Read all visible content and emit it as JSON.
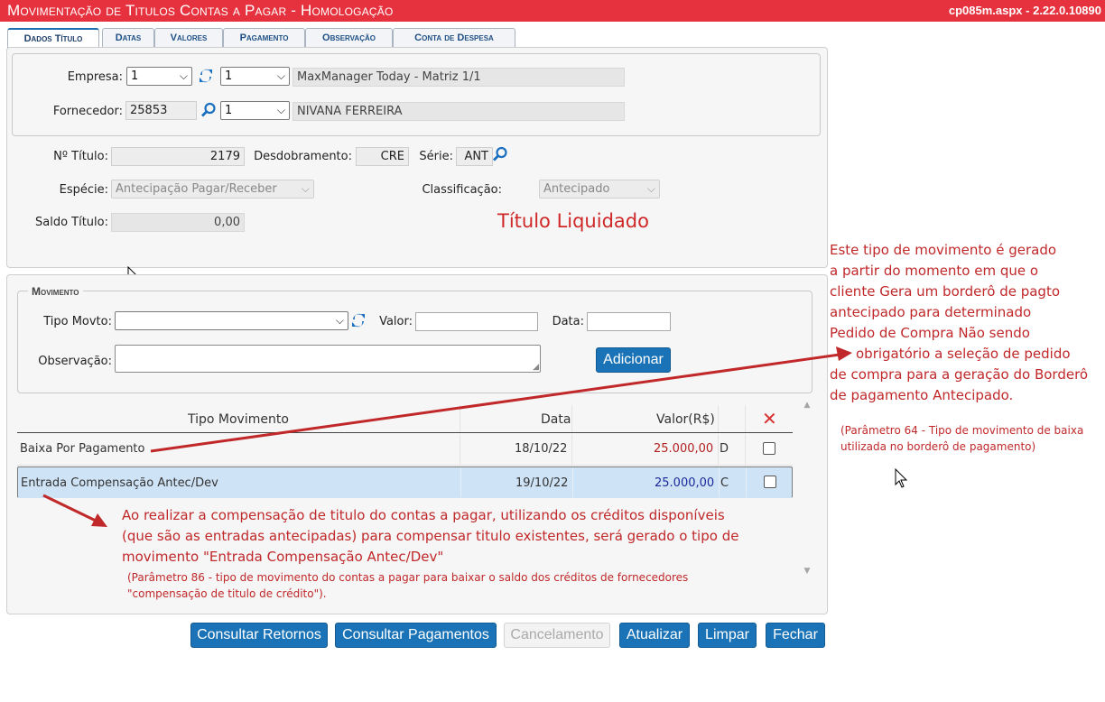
{
  "header": {
    "title": "Movimentação de Titulos Contas a Pagar  - Homologação",
    "version": "cp085m.aspx - 2.22.0.10890",
    "bg_color": "#e5323e"
  },
  "tabs": [
    {
      "label": "Dados Título",
      "active": true
    },
    {
      "label": "Datas",
      "active": false
    },
    {
      "label": "Valores",
      "active": false
    },
    {
      "label": "Pagamento",
      "active": false
    },
    {
      "label": "Observação",
      "active": false
    },
    {
      "label": "Conta de Despesa",
      "active": false
    }
  ],
  "empresa": {
    "label": "Empresa:",
    "select_value": "1",
    "filial_value": "1",
    "name": "MaxManager Today - Matriz 1/1",
    "refresh_icon": "refresh-icon"
  },
  "fornecedor": {
    "label": "Fornecedor:",
    "code": "25853",
    "seq_value": "1",
    "name": "NIVANA FERREIRA",
    "search_icon": "search-icon"
  },
  "titulo": {
    "numero_label": "Nº Título:",
    "numero": "2179",
    "desdobramento_label": "Desdobramento:",
    "desdobramento": "CRE",
    "serie_label": "Série:",
    "serie": "ANT",
    "especie_label": "Espécie:",
    "especie": "Antecipação Pagar/Receber",
    "classificacao_label": "Classificação:",
    "classificacao": "Antecipado",
    "saldo_label": "Saldo Título:",
    "saldo": "0,00",
    "status": "Título Liquidado"
  },
  "movimento": {
    "legend": "Movimento",
    "tipo_label": "Tipo Movto:",
    "tipo_value": "",
    "valor_label": "Valor:",
    "valor_value": "",
    "data_label": "Data:",
    "data_value": "",
    "obs_label": "Observação:",
    "obs_value": "",
    "add_button": "Adicionar"
  },
  "grid": {
    "columns": [
      "Tipo Movimento",
      "Data",
      "Valor(R$)"
    ],
    "delete_icon": "x-icon",
    "rows": [
      {
        "tipo": "Baixa Por Pagamento",
        "data": "18/10/22",
        "valor": "25.000,00",
        "dc": "D",
        "valor_color": "#b22222",
        "checked": false,
        "selected": false
      },
      {
        "tipo": "Entrada Compensação Antec/Dev",
        "data": "19/10/22",
        "valor": "25.000,00",
        "dc": "C",
        "valor_color": "#1a2a9a",
        "checked": false,
        "selected": true
      }
    ]
  },
  "annotations": {
    "right_main": [
      "Este tipo de movimento é gerado",
      "a partir do momento em que o",
      "cliente Gera um borderô de pagto",
      "antecipado para determinado",
      "Pedido de Compra Não sendo",
      "obrigatório a seleção de pedido",
      "de compra para a geração do Borderô",
      "de pagamento Antecipado."
    ],
    "right_param": [
      "(Parâmetro 64 - Tipo de movimento de baixa",
      "utilizada no borderô de pagamento)"
    ],
    "bottom_main": [
      "Ao realizar a compensação de titulo do contas a pagar, utilizando os créditos disponíveis",
      "(que são as entradas antecipadas) para compensar titulo existentes, será gerado o tipo de",
      "movimento \"Entrada Compensação Antec/Dev\""
    ],
    "bottom_param": [
      "(Parâmetro 86 - tipo de movimento do contas a pagar para baixar o saldo dos créditos de fornecedores",
      "\"compensação de titulo de crédito\")."
    ],
    "color": "#c0282a"
  },
  "buttons": [
    {
      "label": "Consultar Retornos",
      "enabled": true
    },
    {
      "label": "Consultar Pagamentos",
      "enabled": true
    },
    {
      "label": "Cancelamento",
      "enabled": false
    },
    {
      "label": "Atualizar",
      "enabled": true
    },
    {
      "label": "Limpar",
      "enabled": true
    },
    {
      "label": "Fechar",
      "enabled": true
    }
  ],
  "accent_color": "#1a73b7"
}
